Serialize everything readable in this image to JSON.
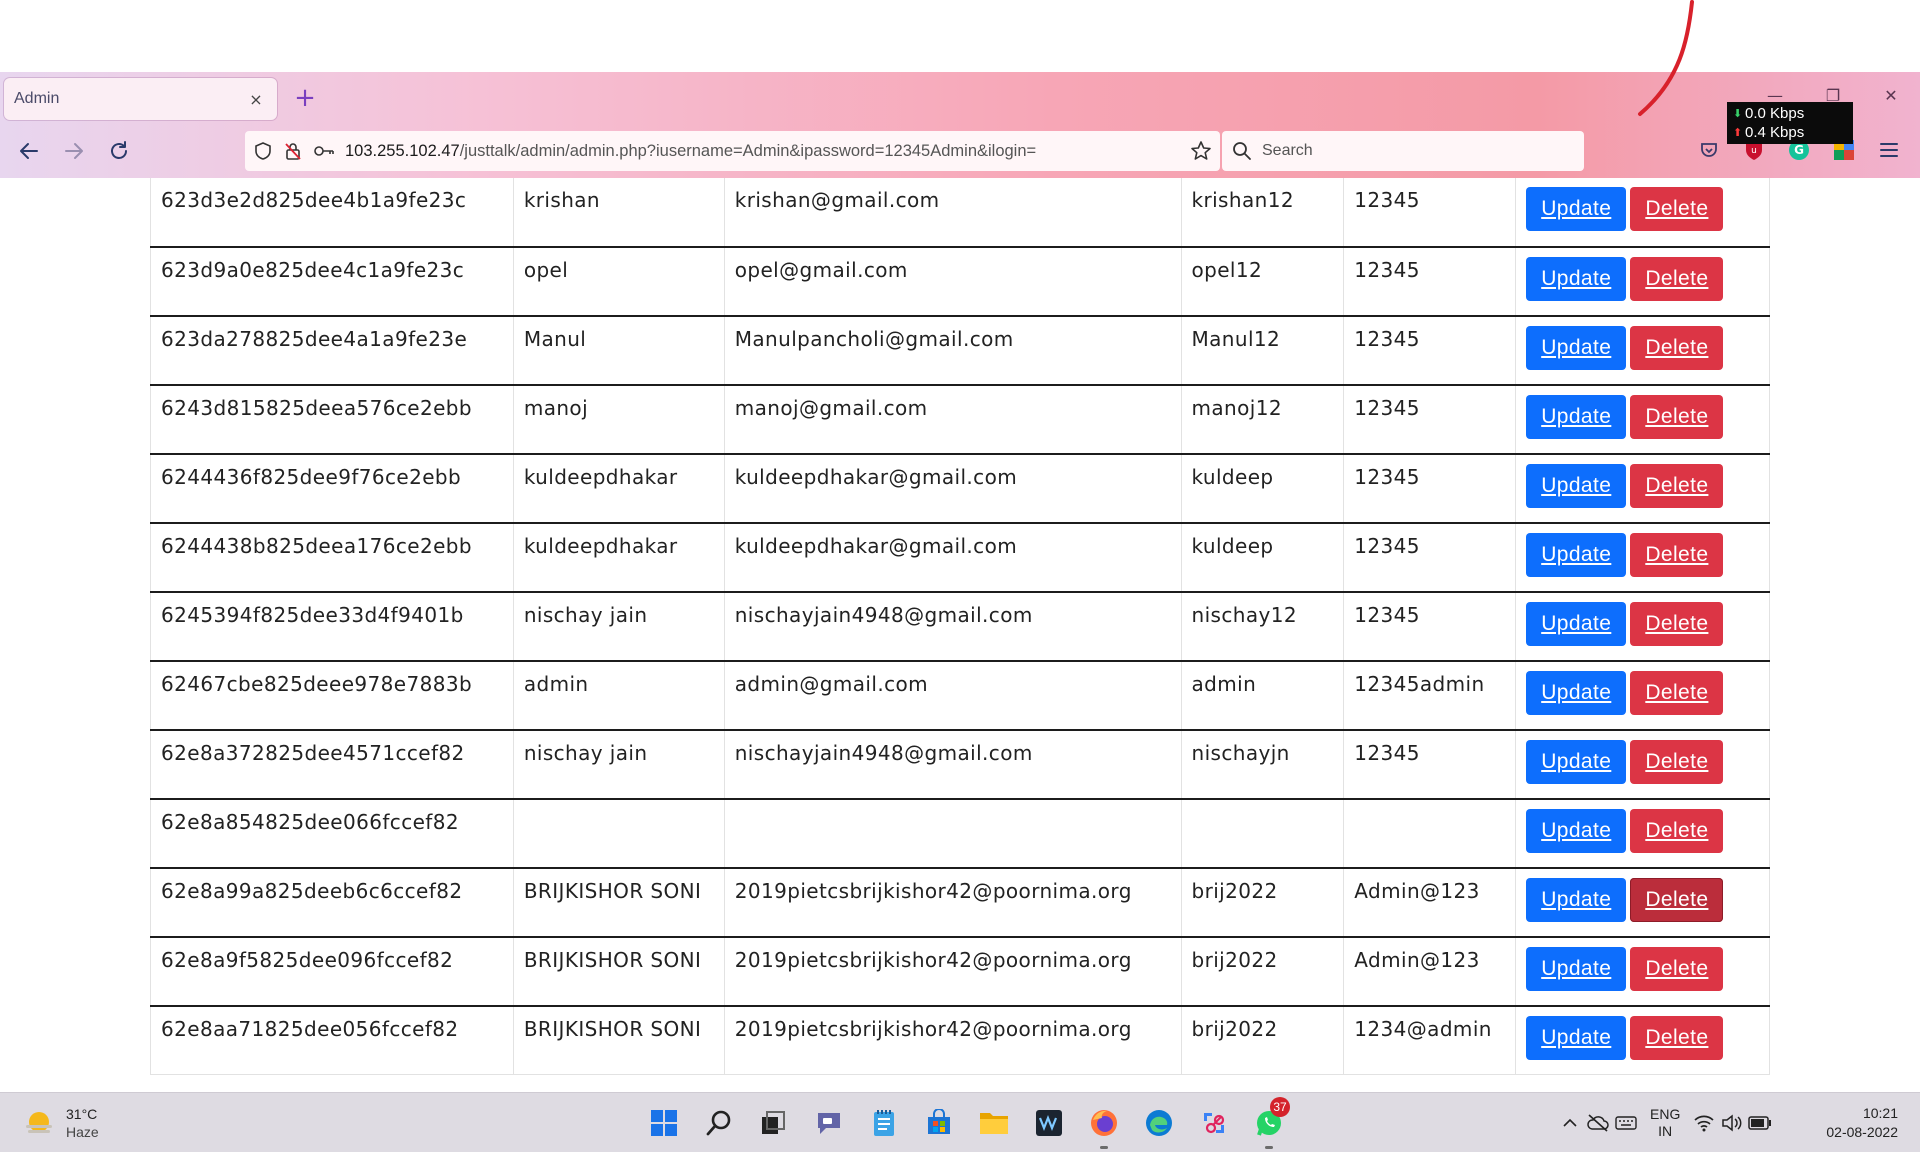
{
  "browser": {
    "tab_title": "Admin",
    "tab_close": "×",
    "new_tab": "+",
    "url_host": "103.255.102.47",
    "url_path": "/justtalk/admin/admin.php?iusername=Admin&ipassword=12345Admin&ilogin=",
    "search_placeholder": "Search",
    "window_controls": [
      "—",
      "❐",
      "✕"
    ]
  },
  "speed_widget": {
    "down": "0.0 Kbps",
    "up": "0.4 Kbps"
  },
  "table": {
    "update_label": "Update",
    "delete_label": "Delete",
    "rows": [
      {
        "id": "623d3e2d825dee4b1a9fe23c",
        "name": "krishan",
        "email": "krishan@gmail.com",
        "username": "krishan12",
        "password": "12345"
      },
      {
        "id": "623d9a0e825dee4c1a9fe23c",
        "name": "opel",
        "email": "opel@gmail.com",
        "username": "opel12",
        "password": "12345"
      },
      {
        "id": "623da278825dee4a1a9fe23e",
        "name": "Manul",
        "email": "Manulpancholi@gmail.com",
        "username": "Manul12",
        "password": "12345"
      },
      {
        "id": "6243d815825deea576ce2ebb",
        "name": "manoj",
        "email": "manoj@gmail.com",
        "username": "manoj12",
        "password": "12345"
      },
      {
        "id": "6244436f825dee9f76ce2ebb",
        "name": "kuldeepdhakar",
        "email": "kuldeepdhakar@gmail.com",
        "username": "kuldeep",
        "password": "12345"
      },
      {
        "id": "6244438b825deea176ce2ebb",
        "name": "kuldeepdhakar",
        "email": "kuldeepdhakar@gmail.com",
        "username": "kuldeep",
        "password": "12345"
      },
      {
        "id": "6245394f825dee33d4f9401b",
        "name": "nischay jain",
        "email": "nischayjain4948@gmail.com",
        "username": "nischay12",
        "password": "12345"
      },
      {
        "id": "62467cbe825deee978e7883b",
        "name": "admin",
        "email": "admin@gmail.com",
        "username": "admin",
        "password": "12345admin"
      },
      {
        "id": "62e8a372825dee4571ccef82",
        "name": "nischay jain",
        "email": "nischayjain4948@gmail.com",
        "username": "nischayjn",
        "password": "12345"
      },
      {
        "id": "62e8a854825dee066fccef82",
        "name": "",
        "email": "",
        "username": "",
        "password": ""
      },
      {
        "id": "62e8a99a825deeb6c6ccef82",
        "name": "BRIJKISHOR SONI",
        "email": "2019pietcsbrijkishor42@poornima.org",
        "username": "brij2022",
        "password": "Admin@123"
      },
      {
        "id": "62e8a9f5825dee096fccef82",
        "name": "BRIJKISHOR SONI",
        "email": "2019pietcsbrijkishor42@poornima.org",
        "username": "brij2022",
        "password": "Admin@123"
      },
      {
        "id": "62e8aa71825dee056fccef82",
        "name": "BRIJKISHOR SONI",
        "email": "2019pietcsbrijkishor42@poornima.org",
        "username": "brij2022",
        "password": "1234@admin"
      }
    ]
  },
  "taskbar": {
    "temperature": "31°C",
    "condition": "Haze",
    "whatsapp_badge": "37",
    "lang_line1": "ENG",
    "lang_line2": "IN",
    "time": "10:21",
    "date": "02-08-2022",
    "apps": [
      "start-icon",
      "search-icon",
      "task-view-icon",
      "teams-chat-icon",
      "notepad-icon",
      "store-icon",
      "file-explorer-icon",
      "waves-app-icon",
      "firefox-icon",
      "edge-icon",
      "snipping-tool-icon",
      "whatsapp-icon"
    ]
  },
  "colors": {
    "update_button": "#0d6efd",
    "delete_button": "#dc3545",
    "annotation_stroke": "#d8212b"
  }
}
